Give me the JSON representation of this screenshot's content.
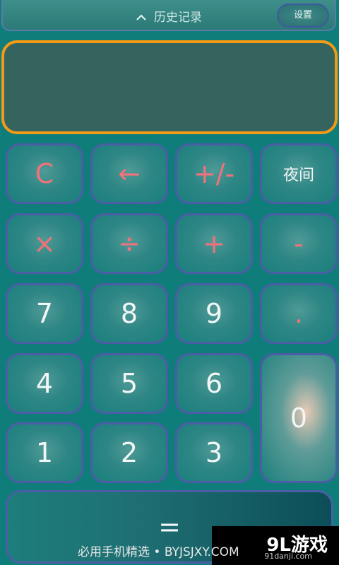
{
  "header": {
    "history_label": "历史记录",
    "settings_label": "设置"
  },
  "display": {
    "value": ""
  },
  "keys": {
    "clear": "C",
    "backspace": "←",
    "negate": "+/-",
    "night": "夜间",
    "multiply": "×",
    "divide": "÷",
    "plus": "+",
    "minus": "-",
    "d7": "7",
    "d8": "8",
    "d9": "9",
    "dot": ".",
    "d4": "4",
    "d5": "5",
    "d6": "6",
    "d0": "0",
    "d1": "1",
    "d2": "2",
    "d3": "3",
    "equals": "="
  },
  "watermark": {
    "text": "必用手机精选 • BYJSJXY.COM",
    "logo": "9L游戏",
    "site": "91danji.com"
  },
  "colors": {
    "background": "#0f7e7a",
    "display_border": "#f39a16",
    "key_border": "#4b5ea5",
    "operator_text": "#f0727a"
  }
}
